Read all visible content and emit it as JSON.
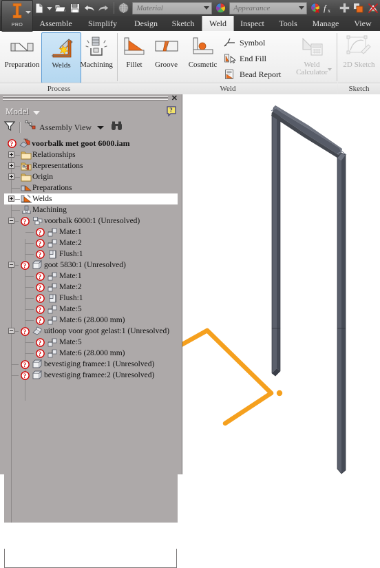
{
  "app": {
    "product_badge": "PRO",
    "logo_icon": "inventor-i-logo-icon"
  },
  "quick_access": {
    "buttons": [
      {
        "name": "new-file-button",
        "icon": "new-document-icon"
      },
      {
        "name": "new-file-dropdown",
        "icon": "chevron-down-icon"
      },
      {
        "name": "open-file-button",
        "icon": "open-folder-icon"
      },
      {
        "name": "save-button",
        "icon": "floppy-disk-icon"
      },
      {
        "name": "undo-button",
        "icon": "undo-arrow-icon"
      },
      {
        "name": "redo-button",
        "icon": "redo-arrow-icon"
      },
      {
        "name": "material-swatch-button",
        "icon": "material-sphere-icon"
      },
      {
        "name": "appearance-color-button",
        "icon": "color-wheel-icon"
      },
      {
        "name": "clear-appearance-override-button",
        "icon": "color-wheel-clear-icon"
      },
      {
        "name": "parameters-button",
        "icon": "fx-function-icon"
      },
      {
        "name": "add-component-button",
        "icon": "plus-icon"
      },
      {
        "name": "update-button",
        "icon": "update-red-square-icon"
      },
      {
        "name": "measure-no-button",
        "icon": "measure-disabled-icon"
      }
    ],
    "material_combo": {
      "name": "material-combo",
      "placeholder": "Material",
      "value": ""
    },
    "appearance_combo": {
      "name": "appearance-combo",
      "placeholder": "Appearance",
      "value": ""
    }
  },
  "ribbon": {
    "tabs": [
      {
        "label": "Assemble",
        "active": false
      },
      {
        "label": "Simplify",
        "active": false
      },
      {
        "label": "Design",
        "active": false
      },
      {
        "label": "Sketch",
        "active": false
      },
      {
        "label": "Weld",
        "active": true
      },
      {
        "label": "Inspect",
        "active": false
      },
      {
        "label": "Tools",
        "active": false
      },
      {
        "label": "Manage",
        "active": false
      },
      {
        "label": "View",
        "active": false
      }
    ],
    "panels": [
      {
        "name": "process",
        "label": "Process",
        "buttons": [
          {
            "label": "Preparation",
            "icon": "preparation-icon",
            "selected": false,
            "disabled": false
          },
          {
            "label": "Welds",
            "icon": "welds-spark-icon",
            "selected": true,
            "disabled": false
          },
          {
            "label": "Machining",
            "icon": "machining-drill-icon",
            "selected": false,
            "disabled": false
          }
        ]
      },
      {
        "name": "weld",
        "label": "Weld",
        "buttons": [
          {
            "label": "Fillet",
            "icon": "fillet-weld-icon",
            "selected": false,
            "disabled": false
          },
          {
            "label": "Groove",
            "icon": "groove-weld-icon",
            "selected": false,
            "disabled": false
          },
          {
            "label": "Cosmetic",
            "icon": "cosmetic-weld-icon",
            "selected": false,
            "disabled": false
          }
        ],
        "small_buttons": [
          {
            "label": "Symbol",
            "icon": "weld-symbol-icon",
            "disabled": false
          },
          {
            "label": "End Fill",
            "icon": "end-fill-icon",
            "disabled": false
          },
          {
            "label": "Bead Report",
            "icon": "bead-report-icon",
            "disabled": false
          }
        ],
        "calculator": {
          "label_line1": "Weld",
          "label_line2": "Calculator",
          "icon": "weld-calculator-icon",
          "disabled": true
        }
      },
      {
        "name": "sketch",
        "label": "Sketch",
        "buttons": [
          {
            "label": "2D Sketch",
            "icon": "2d-sketch-icon",
            "selected": false,
            "disabled": true
          }
        ]
      }
    ]
  },
  "browser": {
    "close_label": "✕",
    "title": "Model",
    "help_icon": "help-question-icon",
    "toolbar": {
      "filter_icon": "filter-funnel-icon",
      "view_icon": "assembly-view-icon",
      "view_label": "Assembly View",
      "search_icon": "binoculars-search-icon"
    },
    "tree": [
      {
        "label": "voorbalk met goot 6000.iam",
        "depth": 0,
        "icon": "assembly-doc-icon",
        "status": "unresolved-question-icon",
        "expander": "none",
        "highlight": false
      },
      {
        "label": "Relationships",
        "depth": 1,
        "icon": "folder-icon",
        "status": "none",
        "expander": "plus",
        "highlight": false
      },
      {
        "label": "Representations",
        "depth": 1,
        "icon": "representations-folder-icon",
        "status": "none",
        "expander": "plus",
        "highlight": false
      },
      {
        "label": "Origin",
        "depth": 1,
        "icon": "folder-icon",
        "status": "none",
        "expander": "plus",
        "highlight": false
      },
      {
        "label": "Preparations",
        "depth": 1,
        "icon": "preparations-icon",
        "status": "none",
        "expander": "none",
        "highlight": false
      },
      {
        "label": "Welds",
        "depth": 1,
        "icon": "welds-icon",
        "status": "none",
        "expander": "plus",
        "highlight": true
      },
      {
        "label": "Machining",
        "depth": 1,
        "icon": "machining-icon",
        "status": "none",
        "expander": "none",
        "highlight": false
      },
      {
        "label": "voorbalk 6000:1 (Unresolved)",
        "depth": 1,
        "icon": "subassembly-icon",
        "status": "unresolved-question-icon",
        "expander": "minus",
        "highlight": false
      },
      {
        "label": "Mate:1",
        "depth": 2,
        "icon": "mate-constraint-icon",
        "status": "unresolved-question-icon",
        "expander": "none",
        "highlight": false
      },
      {
        "label": "Mate:2",
        "depth": 2,
        "icon": "mate-constraint-icon",
        "status": "unresolved-question-icon",
        "expander": "none",
        "highlight": false
      },
      {
        "label": "Flush:1",
        "depth": 2,
        "icon": "flush-constraint-icon",
        "status": "unresolved-question-icon",
        "expander": "none",
        "highlight": false
      },
      {
        "label": "goot 5830:1 (Unresolved)",
        "depth": 1,
        "icon": "part-box-icon",
        "status": "unresolved-question-icon",
        "expander": "minus",
        "highlight": false
      },
      {
        "label": "Mate:1",
        "depth": 2,
        "icon": "mate-constraint-icon",
        "status": "unresolved-question-icon",
        "expander": "none",
        "highlight": false
      },
      {
        "label": "Mate:2",
        "depth": 2,
        "icon": "mate-constraint-icon",
        "status": "unresolved-question-icon",
        "expander": "none",
        "highlight": false
      },
      {
        "label": "Flush:1",
        "depth": 2,
        "icon": "flush-constraint-icon",
        "status": "unresolved-question-icon",
        "expander": "none",
        "highlight": false
      },
      {
        "label": "Mate:5",
        "depth": 2,
        "icon": "mate-constraint-icon",
        "status": "unresolved-question-icon",
        "expander": "none",
        "highlight": false
      },
      {
        "label": "Mate:6 (28.000 mm)",
        "depth": 2,
        "icon": "mate-constraint-icon",
        "status": "unresolved-question-icon",
        "expander": "none",
        "highlight": false
      },
      {
        "label": "uitloop voor goot gelast:1 (Unresolved)",
        "depth": 1,
        "icon": "weldment-part-icon",
        "status": "unresolved-question-icon",
        "expander": "minus",
        "highlight": false
      },
      {
        "label": "Mate:5",
        "depth": 2,
        "icon": "mate-constraint-icon",
        "status": "unresolved-question-icon",
        "expander": "none",
        "highlight": false
      },
      {
        "label": "Mate:6 (28.000 mm)",
        "depth": 2,
        "icon": "mate-constraint-icon",
        "status": "unresolved-question-icon",
        "expander": "none",
        "highlight": false
      },
      {
        "label": "bevestiging framee:1 (Unresolved)",
        "depth": 1,
        "icon": "part-box-icon",
        "status": "unresolved-question-icon",
        "expander": "none",
        "highlight": false
      },
      {
        "label": "bevestiging framee:2 (Unresolved)",
        "depth": 1,
        "icon": "part-box-icon",
        "status": "unresolved-question-icon",
        "expander": "none",
        "highlight": false
      }
    ]
  },
  "viewport": {
    "name": "3d-graphics-window",
    "background": "#ffffff",
    "frame_color": "#4a4e5a",
    "frame_color_light": "#6c7180",
    "frame_color_dark": "#383c46",
    "highlight_color": "#f5a01e"
  }
}
